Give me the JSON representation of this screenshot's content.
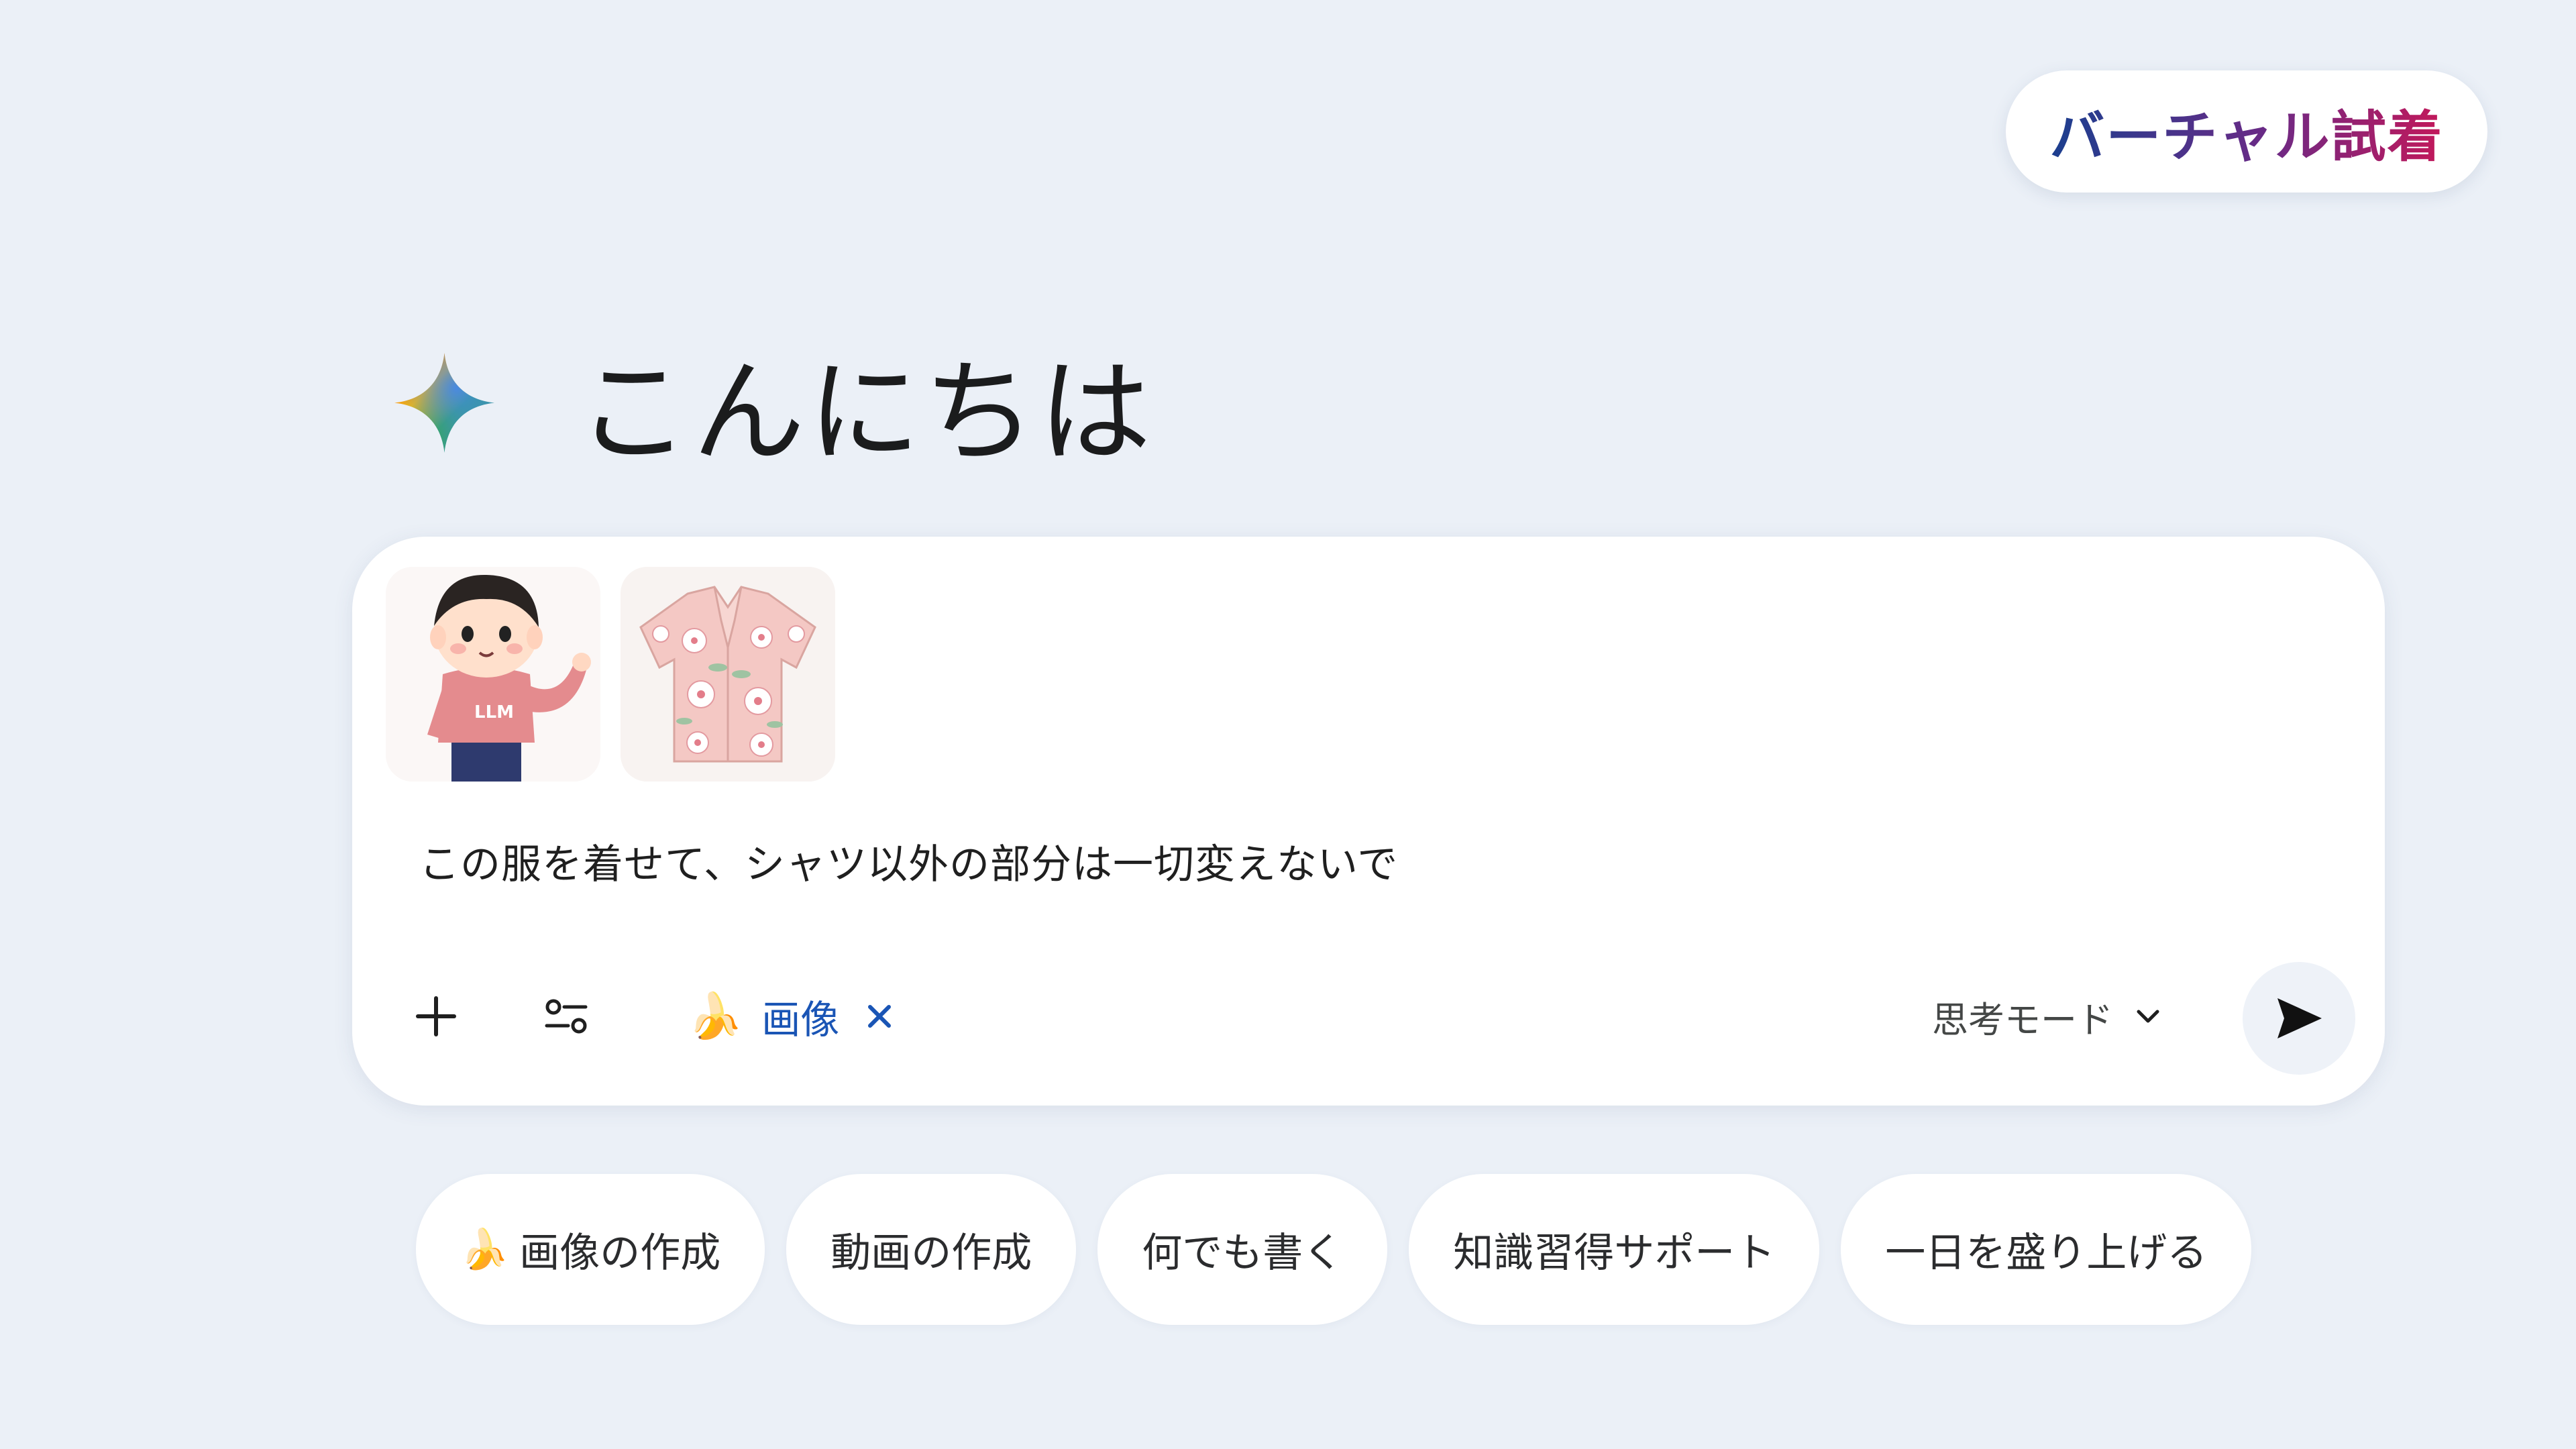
{
  "badge": {
    "label": "バーチャル試着"
  },
  "greeting": {
    "text": "こんにちは",
    "icon": "gemini-spark-icon"
  },
  "prompt": {
    "attachments": [
      {
        "name": "character-image",
        "icon": "character-thumbnail"
      },
      {
        "name": "shirt-image",
        "icon": "aloha-shirt-thumbnail"
      }
    ],
    "text": "この服を着せて、シャツ以外の部分は一切変えないで",
    "toolbar": {
      "add_icon": "plus-icon",
      "tools_icon": "tools-icon",
      "tool_chip": {
        "emoji": "🍌",
        "label": "画像",
        "close_icon": "close-icon"
      },
      "mode_label": "思考モード",
      "mode_icon": "chevron-down-icon",
      "send_icon": "send-icon"
    }
  },
  "suggestions": [
    {
      "emoji": "🍌",
      "label": "画像の作成"
    },
    {
      "label": "動画の作成"
    },
    {
      "label": "何でも書く"
    },
    {
      "label": "知識習得サポート"
    },
    {
      "label": "一日を盛り上げる"
    }
  ],
  "colors": {
    "background": "#ebf0f7",
    "card": "#ffffff",
    "accent_blue": "#1a55b5",
    "badge_gradient_start": "#1b3f8f",
    "badge_gradient_end": "#c3185a"
  }
}
